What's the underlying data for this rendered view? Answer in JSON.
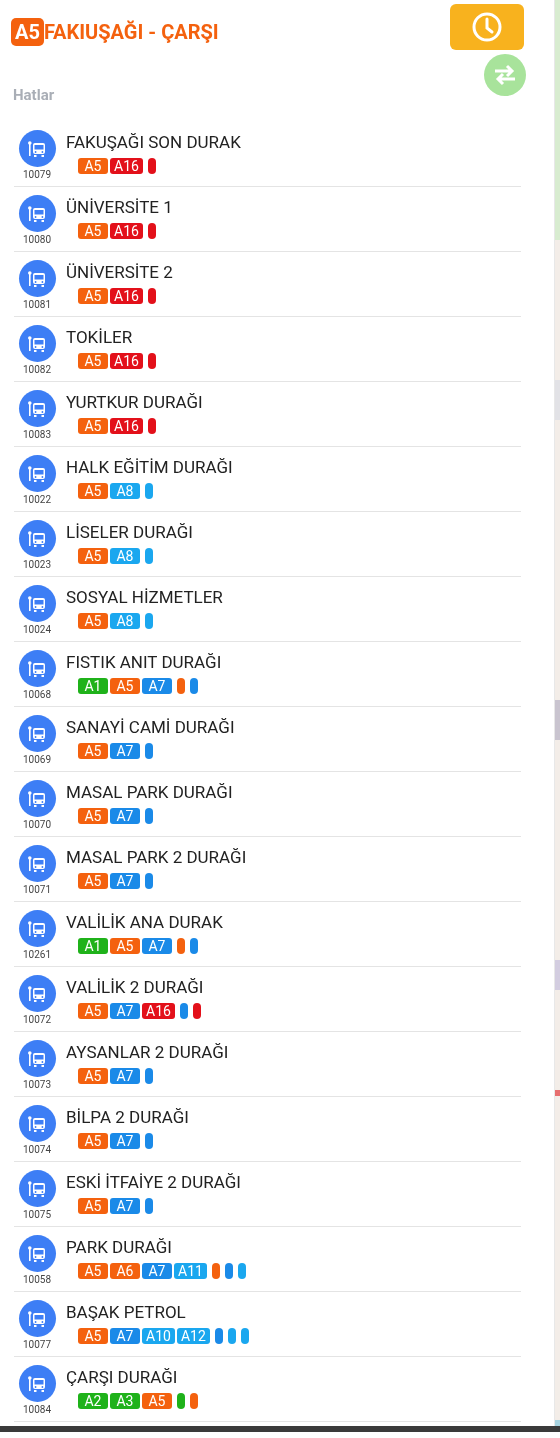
{
  "header": {
    "route_badge": "A5",
    "title": "FAKIUŞAĞI - ÇARŞI"
  },
  "section_label": "Hatlar",
  "stops": [
    {
      "name": "FAKUŞAĞI SON DURAK",
      "code": "10079",
      "routes": [
        {
          "label": "A5",
          "color": "#f4610e"
        },
        {
          "label": "A16",
          "color": "#e3101a"
        }
      ],
      "dots": [
        {
          "color": "#e3101a"
        }
      ]
    },
    {
      "name": "ÜNİVERSİTE 1",
      "code": "10080",
      "routes": [
        {
          "label": "A5",
          "color": "#f4610e"
        },
        {
          "label": "A16",
          "color": "#e3101a"
        }
      ],
      "dots": [
        {
          "color": "#e3101a"
        }
      ]
    },
    {
      "name": "ÜNİVERSİTE 2",
      "code": "10081",
      "routes": [
        {
          "label": "A5",
          "color": "#f4610e"
        },
        {
          "label": "A16",
          "color": "#e3101a"
        }
      ],
      "dots": [
        {
          "color": "#e3101a"
        }
      ]
    },
    {
      "name": "TOKİLER",
      "code": "10082",
      "routes": [
        {
          "label": "A5",
          "color": "#f4610e"
        },
        {
          "label": "A16",
          "color": "#e3101a"
        }
      ],
      "dots": [
        {
          "color": "#e3101a"
        }
      ]
    },
    {
      "name": "YURTKUR DURAĞI",
      "code": "10083",
      "routes": [
        {
          "label": "A5",
          "color": "#f4610e"
        },
        {
          "label": "A16",
          "color": "#e3101a"
        }
      ],
      "dots": [
        {
          "color": "#e3101a"
        }
      ]
    },
    {
      "name": "HALK EĞİTİM DURAĞI",
      "code": "10022",
      "routes": [
        {
          "label": "A5",
          "color": "#f4610e"
        },
        {
          "label": "A8",
          "color": "#1aa7ef"
        }
      ],
      "dots": [
        {
          "color": "#1aa7ef"
        }
      ]
    },
    {
      "name": "LİSELER DURAĞI",
      "code": "10023",
      "routes": [
        {
          "label": "A5",
          "color": "#f4610e"
        },
        {
          "label": "A8",
          "color": "#1aa7ef"
        }
      ],
      "dots": [
        {
          "color": "#1aa7ef"
        }
      ]
    },
    {
      "name": "SOSYAL HİZMETLER",
      "code": "10024",
      "routes": [
        {
          "label": "A5",
          "color": "#f4610e"
        },
        {
          "label": "A8",
          "color": "#1aa7ef"
        }
      ],
      "dots": [
        {
          "color": "#1aa7ef"
        }
      ]
    },
    {
      "name": "FISTIK ANIT DURAĞI",
      "code": "10068",
      "routes": [
        {
          "label": "A1",
          "color": "#1fb21a"
        },
        {
          "label": "A5",
          "color": "#f4610e"
        },
        {
          "label": "A7",
          "color": "#1a8ae8"
        }
      ],
      "dots": [
        {
          "color": "#f4610e"
        },
        {
          "color": "#1a8ae8"
        }
      ]
    },
    {
      "name": "SANAYİ CAMİ DURAĞI",
      "code": "10069",
      "routes": [
        {
          "label": "A5",
          "color": "#f4610e"
        },
        {
          "label": "A7",
          "color": "#1a8ae8"
        }
      ],
      "dots": [
        {
          "color": "#1a8ae8"
        }
      ]
    },
    {
      "name": "MASAL PARK DURAĞI",
      "code": "10070",
      "routes": [
        {
          "label": "A5",
          "color": "#f4610e"
        },
        {
          "label": "A7",
          "color": "#1a8ae8"
        }
      ],
      "dots": [
        {
          "color": "#1a8ae8"
        }
      ]
    },
    {
      "name": "MASAL PARK 2 DURAĞI",
      "code": "10071",
      "routes": [
        {
          "label": "A5",
          "color": "#f4610e"
        },
        {
          "label": "A7",
          "color": "#1a8ae8"
        }
      ],
      "dots": [
        {
          "color": "#1a8ae8"
        }
      ]
    },
    {
      "name": "VALİLİK ANA DURAK",
      "code": "10261",
      "routes": [
        {
          "label": "A1",
          "color": "#1fb21a"
        },
        {
          "label": "A5",
          "color": "#f4610e"
        },
        {
          "label": "A7",
          "color": "#1a8ae8"
        }
      ],
      "dots": [
        {
          "color": "#f4610e"
        },
        {
          "color": "#1a8ae8"
        }
      ]
    },
    {
      "name": "VALİLİK 2 DURAĞI",
      "code": "10072",
      "routes": [
        {
          "label": "A5",
          "color": "#f4610e"
        },
        {
          "label": "A7",
          "color": "#1a8ae8"
        },
        {
          "label": "A16",
          "color": "#e3101a"
        }
      ],
      "dots": [
        {
          "color": "#1a8ae8"
        },
        {
          "color": "#e3101a"
        }
      ]
    },
    {
      "name": "AYSANLAR 2 DURAĞI",
      "code": "10073",
      "routes": [
        {
          "label": "A5",
          "color": "#f4610e"
        },
        {
          "label": "A7",
          "color": "#1a8ae8"
        }
      ],
      "dots": [
        {
          "color": "#1a8ae8"
        }
      ]
    },
    {
      "name": "BİLPA 2 DURAĞI",
      "code": "10074",
      "routes": [
        {
          "label": "A5",
          "color": "#f4610e"
        },
        {
          "label": "A7",
          "color": "#1a8ae8"
        }
      ],
      "dots": [
        {
          "color": "#1a8ae8"
        }
      ]
    },
    {
      "name": "ESKİ İTFAİYE 2 DURAĞI",
      "code": "10075",
      "routes": [
        {
          "label": "A5",
          "color": "#f4610e"
        },
        {
          "label": "A7",
          "color": "#1a8ae8"
        }
      ],
      "dots": [
        {
          "color": "#1a8ae8"
        }
      ]
    },
    {
      "name": "PARK DURAĞI",
      "code": "10058",
      "routes": [
        {
          "label": "A5",
          "color": "#f4610e"
        },
        {
          "label": "A6",
          "color": "#f4610e"
        },
        {
          "label": "A7",
          "color": "#1a8ae8"
        },
        {
          "label": "A11",
          "color": "#1aa7ef"
        }
      ],
      "dots": [
        {
          "color": "#f4610e"
        },
        {
          "color": "#1a8ae8"
        },
        {
          "color": "#1aa7ef"
        }
      ]
    },
    {
      "name": "BAŞAK PETROL",
      "code": "10077",
      "routes": [
        {
          "label": "A5",
          "color": "#f4610e"
        },
        {
          "label": "A7",
          "color": "#1a8ae8"
        },
        {
          "label": "A10",
          "color": "#1aa7ef"
        },
        {
          "label": "A12",
          "color": "#1aa7ef"
        }
      ],
      "dots": [
        {
          "color": "#1a8ae8"
        },
        {
          "color": "#1aa7ef"
        },
        {
          "color": "#1aa7ef"
        }
      ]
    },
    {
      "name": "ÇARŞI DURAĞI",
      "code": "10084",
      "routes": [
        {
          "label": "A2",
          "color": "#1fb21a"
        },
        {
          "label": "A3",
          "color": "#1fb21a"
        },
        {
          "label": "A5",
          "color": "#f4610e"
        }
      ],
      "dots": [
        {
          "color": "#1fb21a"
        },
        {
          "color": "#f4610e"
        }
      ]
    }
  ]
}
